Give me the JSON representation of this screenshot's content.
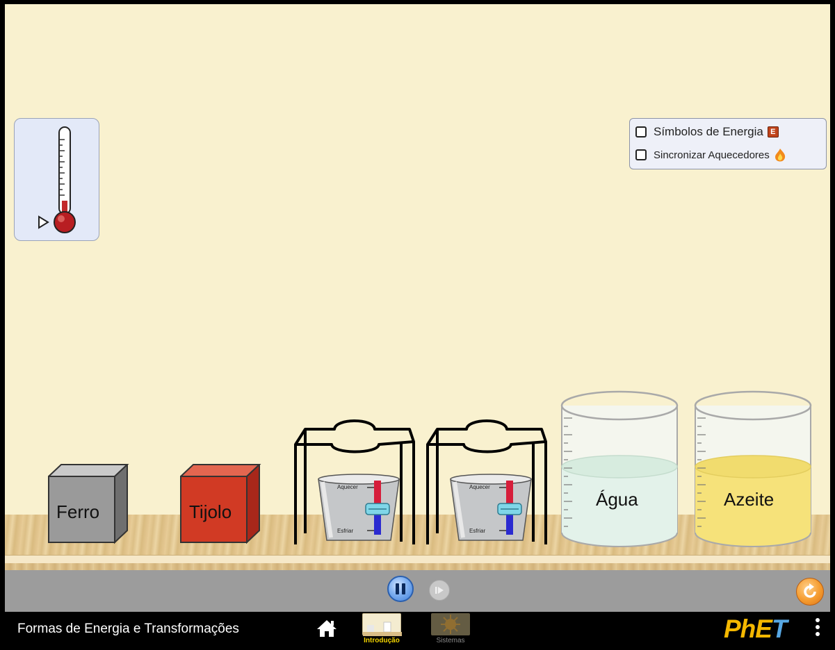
{
  "simulation": {
    "title": "Formas de Energia e Transformações"
  },
  "options_panel": {
    "energy_symbols": {
      "label": "Símbolos de Energia",
      "checked": false,
      "icon": "energy-chunk-icon",
      "icon_letter": "E"
    },
    "link_heaters": {
      "label": "Sincronizar Aquecedores",
      "checked": false,
      "icon": "flame-icon"
    }
  },
  "blocks": [
    {
      "label": "Ferro",
      "color": "#9a9a9a"
    },
    {
      "label": "Tijolo",
      "color": "#d13a24"
    }
  ],
  "burners": [
    {
      "heat_label": "Aquecer",
      "cool_label": "Esfriar",
      "level": 0
    },
    {
      "heat_label": "Aquecer",
      "cool_label": "Esfriar",
      "level": 0
    }
  ],
  "beakers": [
    {
      "label": "Água",
      "liquid_color": "#e3f2ea"
    },
    {
      "label": "Azeite",
      "liquid_color": "#f6e27a"
    }
  ],
  "controls": {
    "play_pause": "pause-icon",
    "step": "step-forward-icon",
    "reset": "reset-icon"
  },
  "navbar": {
    "screens": [
      {
        "label": "Introdução",
        "selected": true
      },
      {
        "label": "Sistemas",
        "selected": false
      }
    ],
    "logo": {
      "part1": "PhET",
      "ph": "PhE",
      "et": "T"
    }
  },
  "colors": {
    "background": "#f9f1cf",
    "control_bar": "#9c9c9c",
    "accent_play": "#3f7fd9",
    "accent_reset": "#f59b2e"
  }
}
